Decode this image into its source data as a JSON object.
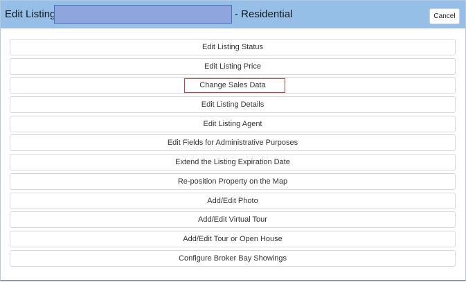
{
  "header": {
    "title_label": "Edit Listing:",
    "title_suffix": "- Residential",
    "cancel_label": "Cancel"
  },
  "menu": {
    "items": [
      {
        "label": "Edit Listing Status"
      },
      {
        "label": "Edit Listing Price"
      },
      {
        "label": "Change Sales Data"
      },
      {
        "label": "Edit Listing Details"
      },
      {
        "label": "Edit Listing Agent"
      },
      {
        "label": "Edit Fields for Administrative Purposes"
      },
      {
        "label": "Extend the Listing Expiration Date"
      },
      {
        "label": "Re-position Property on the Map"
      },
      {
        "label": "Add/Edit Photo"
      },
      {
        "label": "Add/Edit Virtual Tour"
      },
      {
        "label": "Add/Edit Tour or Open House"
      },
      {
        "label": "Configure Broker Bay Showings"
      }
    ]
  }
}
